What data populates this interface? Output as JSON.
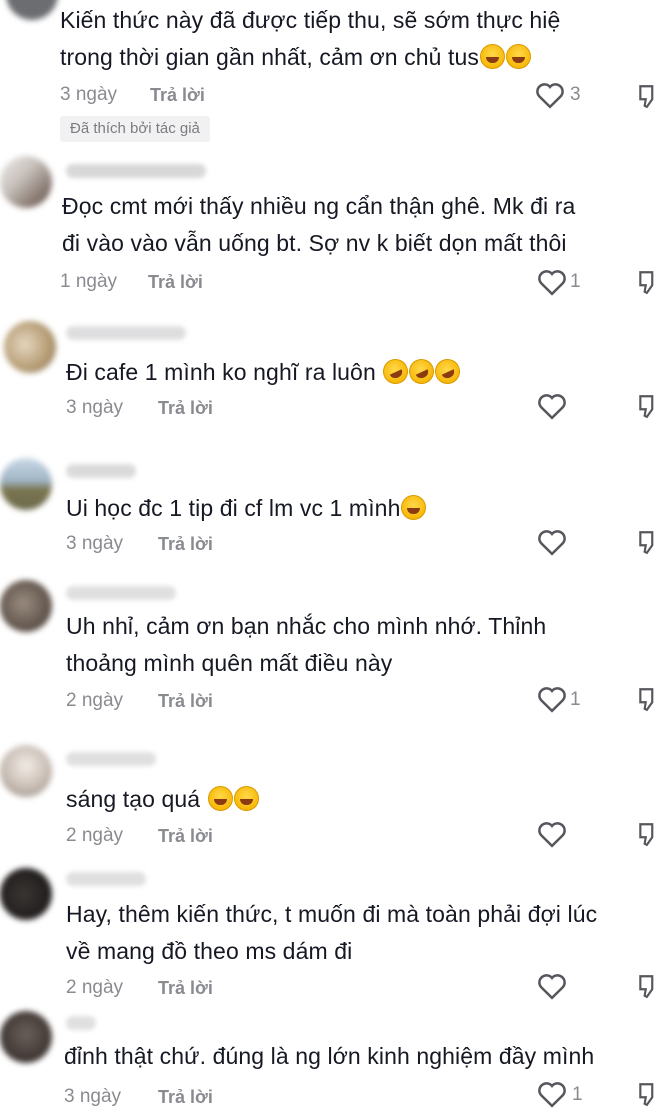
{
  "reply_label": "Trả lời",
  "author_liked_badge": "Đã thích bởi tác giả",
  "comments": [
    {
      "lines": [
        "Kiến thức này đã được tiếp thu, sẽ sớm thực hiệ",
        "trong thời gian gần nhất, cảm ơn chủ tus"
      ],
      "time": "3 ngày",
      "likes": "3"
    },
    {
      "lines": [
        "Đọc cmt mới thấy nhiều ng cẩn thận ghê. Mk đi ra",
        "đi vào vào vẫn uống bt. Sợ nv k biết dọn mất thôi"
      ],
      "time": "1 ngày",
      "likes": "1"
    },
    {
      "lines": [
        "Đi cafe 1 mình ko nghĩ ra luôn"
      ],
      "time": "3 ngày",
      "likes": ""
    },
    {
      "lines": [
        "Ui học đc 1 tip đi cf lm vc 1 mình"
      ],
      "time": "3 ngày",
      "likes": ""
    },
    {
      "lines": [
        "Uh nhỉ, cảm ơn bạn nhắc cho mình nhớ. Thỉnh",
        "thoảng mình quên mất điều này"
      ],
      "time": "2 ngày",
      "likes": "1"
    },
    {
      "lines": [
        "sáng tạo quá"
      ],
      "time": "2 ngày",
      "likes": ""
    },
    {
      "lines": [
        "Hay, thêm kiến thức, t muốn đi mà toàn phải đợi lúc",
        "về mang đồ theo ms dám đi"
      ],
      "time": "2 ngày",
      "likes": ""
    },
    {
      "lines": [
        "đỉnh thật chứ. đúng là ng lớn kinh nghiệm đầy mình"
      ],
      "time": "3 ngày",
      "likes": "1"
    }
  ],
  "icons": {
    "like": "heart-outline-icon",
    "dislike": "thumbs-down-outline-icon",
    "emoji_grin": "grinning-face-emoji",
    "emoji_joy": "tears-of-joy-emoji",
    "emoji_rofl": "rofl-emoji"
  }
}
